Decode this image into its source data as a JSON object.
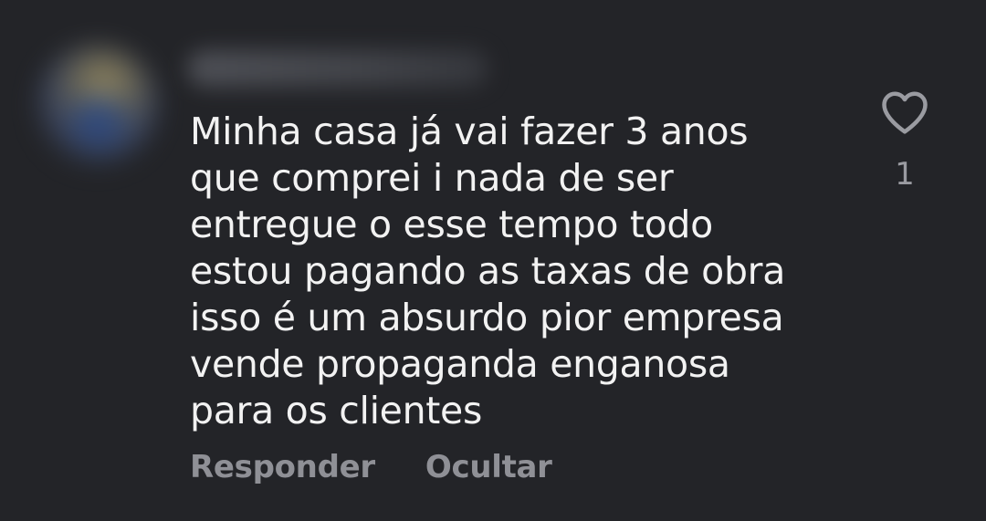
{
  "comment": {
    "text": "Minha casa já vai fazer 3 anos\nque comprei i nada de ser\nentregue o esse tempo todo\nestou pagando as taxas de obra\nisso é um absurdo pior empresa\nvende propaganda enganosa\npara os clientes",
    "like_count": "1",
    "like_icon": "heart-outline-icon"
  },
  "actions": {
    "reply_label": "Responder",
    "hide_label": "Ocultar"
  },
  "colors": {
    "background": "#232428",
    "text": "#f2f2f2",
    "muted": "#8f9096"
  }
}
